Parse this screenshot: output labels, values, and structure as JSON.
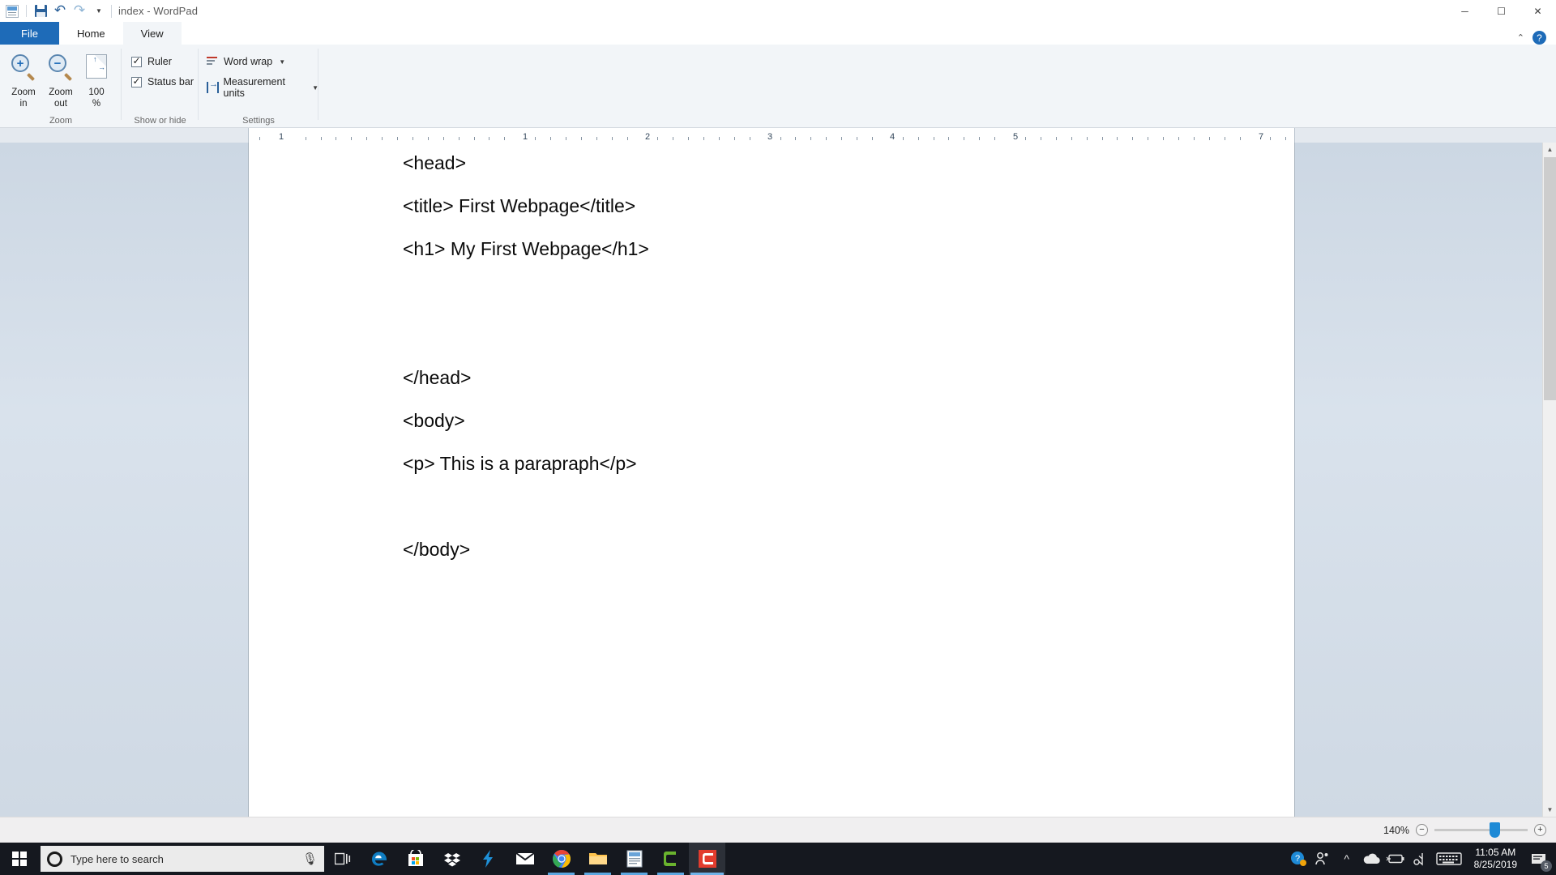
{
  "window": {
    "title": "index - WordPad",
    "quick_access": [
      {
        "name": "wordpad-logo",
        "label": "WordPad"
      },
      {
        "name": "save",
        "label": "Save"
      },
      {
        "name": "undo",
        "label": "Undo"
      },
      {
        "name": "redo",
        "label": "Redo"
      },
      {
        "name": "customize",
        "label": "Customize Quick Access Toolbar"
      }
    ],
    "controls": {
      "minimize": "─",
      "maximize": "☐",
      "close": "✕"
    }
  },
  "tabs": [
    {
      "label": "File",
      "state": "file"
    },
    {
      "label": "Home",
      "state": "inactive"
    },
    {
      "label": "View",
      "state": "active"
    }
  ],
  "tabstrip_right": {
    "collapse_ribbon": "⌃",
    "help": "?"
  },
  "ribbon": {
    "groups": [
      {
        "label": "Zoom",
        "buttons": [
          {
            "name": "zoom-in",
            "label_line1": "Zoom",
            "label_line2": "in",
            "glyph": "+"
          },
          {
            "name": "zoom-out",
            "label_line1": "Zoom",
            "label_line2": "out",
            "glyph": "−"
          },
          {
            "name": "zoom-100",
            "label_line1": "100",
            "label_line2": "%",
            "glyph": "page"
          }
        ]
      },
      {
        "label": "Show or hide",
        "checkboxes": [
          {
            "name": "ruler",
            "label": "Ruler",
            "checked": true
          },
          {
            "name": "status-bar",
            "label": "Status bar",
            "checked": true
          }
        ]
      },
      {
        "label": "Settings",
        "items": [
          {
            "name": "word-wrap",
            "label": "Word wrap",
            "has_menu": true
          },
          {
            "name": "measurement-units",
            "label": "Measurement units",
            "has_menu": true
          }
        ]
      }
    ]
  },
  "ruler": {
    "numbers": [
      "1",
      "1",
      "2",
      "3",
      "4",
      "5",
      "7"
    ],
    "unit": "inches"
  },
  "document": {
    "lines": [
      "<head>",
      "<title> First Webpage</title>",
      "<h1> My First Webpage</h1>",
      "</head>",
      "<body>",
      "<p> This is a parapraph</p>",
      "</body>"
    ]
  },
  "status_bar": {
    "zoom_percent": "140%",
    "zoom_out_label": "−",
    "zoom_in_label": "+"
  },
  "taskbar": {
    "search_placeholder": "Type here to search",
    "apps": [
      {
        "name": "task-view",
        "label": "Task View"
      },
      {
        "name": "microsoft-edge",
        "label": "Microsoft Edge"
      },
      {
        "name": "microsoft-store",
        "label": "Microsoft Store"
      },
      {
        "name": "dropbox",
        "label": "Dropbox"
      },
      {
        "name": "lightning-app",
        "label": "Lightning"
      },
      {
        "name": "mail",
        "label": "Mail"
      },
      {
        "name": "google-chrome",
        "label": "Google Chrome"
      },
      {
        "name": "file-explorer",
        "label": "File Explorer"
      },
      {
        "name": "wordpad",
        "label": "WordPad"
      },
      {
        "name": "camtasia",
        "label": "Camtasia"
      },
      {
        "name": "camtasia-recorder",
        "label": "Camtasia Recorder"
      }
    ],
    "tray": [
      {
        "name": "help-support",
        "label": "Help and Support"
      },
      {
        "name": "people",
        "label": "People"
      },
      {
        "name": "show-hidden-icons",
        "label": "Show hidden icons"
      },
      {
        "name": "onedrive",
        "label": "OneDrive"
      },
      {
        "name": "battery",
        "label": "Battery"
      },
      {
        "name": "bluetooth-headset",
        "label": "Audio device"
      },
      {
        "name": "touch-keyboard",
        "label": "Touch keyboard"
      }
    ],
    "clock": {
      "time": "11:05 AM",
      "date": "8/25/2019"
    },
    "notifications": {
      "count": "5"
    }
  },
  "colors": {
    "accent": "#1e6bb8",
    "ribbon_bg": "#f2f5f8",
    "taskbar_bg": "#15181f",
    "slider_blue": "#1e8ad6"
  }
}
